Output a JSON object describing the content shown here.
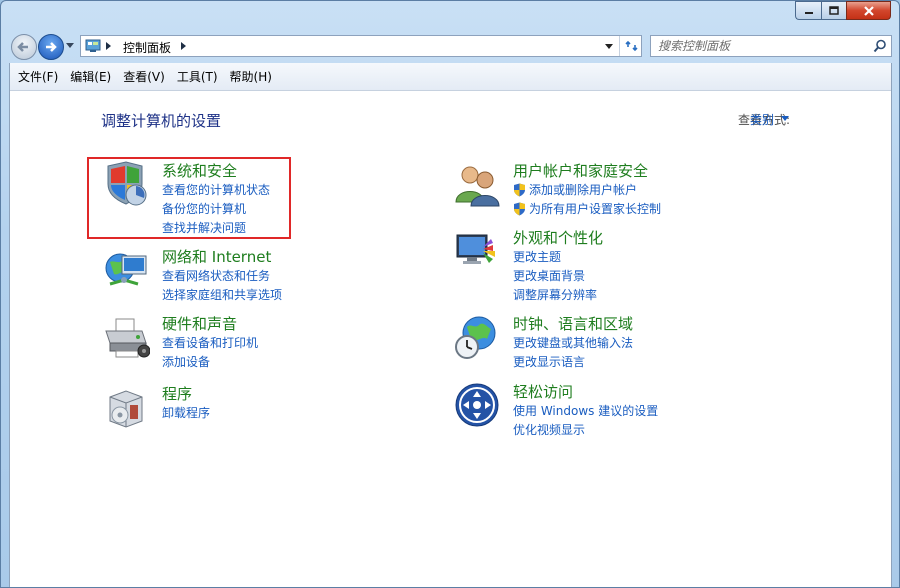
{
  "address": {
    "crumb": "控制面板"
  },
  "search": {
    "placeholder": "搜索控制面板"
  },
  "menu": [
    "文件(F)",
    "编辑(E)",
    "查看(V)",
    "工具(T)",
    "帮助(H)"
  ],
  "heading": "调整计算机的设置",
  "view": {
    "label": "查看方式:",
    "value": "类别"
  },
  "categories": {
    "security": {
      "title": "系统和安全",
      "links": [
        "查看您的计算机状态",
        "备份您的计算机",
        "查找并解决问题"
      ]
    },
    "network": {
      "title": "网络和 Internet",
      "links": [
        "查看网络状态和任务",
        "选择家庭组和共享选项"
      ]
    },
    "hardware": {
      "title": "硬件和声音",
      "links": [
        "查看设备和打印机",
        "添加设备"
      ]
    },
    "programs": {
      "title": "程序",
      "links": [
        "卸载程序"
      ]
    },
    "users": {
      "title": "用户帐户和家庭安全",
      "links": [
        "添加或删除用户帐户",
        "为所有用户设置家长控制"
      ]
    },
    "appearance": {
      "title": "外观和个性化",
      "links": [
        "更改主题",
        "更改桌面背景",
        "调整屏幕分辨率"
      ]
    },
    "clock": {
      "title": "时钟、语言和区域",
      "links": [
        "更改键盘或其他输入法",
        "更改显示语言"
      ]
    },
    "ease": {
      "title": "轻松访问",
      "links": [
        "使用 Windows 建议的设置",
        "优化视频显示"
      ]
    }
  }
}
